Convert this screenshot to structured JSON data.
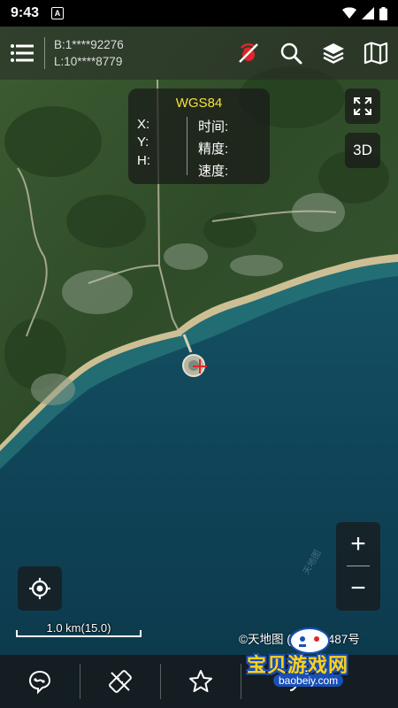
{
  "status_bar": {
    "time": "9:43",
    "notification_glyph": "A"
  },
  "toolbar": {
    "coord_b": "B:1****92276",
    "coord_l": "L:10****8779",
    "icons": [
      "menu-icon",
      "gps-off-icon",
      "search-icon",
      "layers-icon",
      "map-icon"
    ]
  },
  "info_panel": {
    "title": "WGS84",
    "x_label": "X:",
    "y_label": "Y:",
    "h_label": "H:",
    "time_label": "时间:",
    "accuracy_label": "精度:",
    "speed_label": "速度:"
  },
  "map_controls": {
    "fullscreen_icon": "fullscreen-icon",
    "three_d_label": "3D",
    "zoom_in_label": "+",
    "zoom_out_label": "−"
  },
  "scale": {
    "text": "1.0 km(15.0)"
  },
  "copyright": "©天地图 (2021)1487号",
  "bottom_nav": {
    "icons": [
      "track-icon",
      "no-measure-icon",
      "star-icon",
      "route-icon"
    ]
  },
  "watermark": {
    "title": "宝贝游戏网",
    "url": "baobeiy.com"
  },
  "colors": {
    "accent_yellow": "#f4e23a",
    "gps_off_red": "#e0262b",
    "water": "#0f4256",
    "land": "#3b5a2e"
  }
}
